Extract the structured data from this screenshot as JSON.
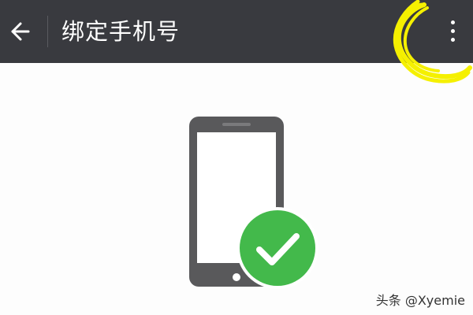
{
  "header": {
    "title": "绑定手机号",
    "back_icon": "arrow-left-icon",
    "more_icon": "more-vertical-icon",
    "background_color": "#393a3f",
    "text_color": "#ffffff"
  },
  "annotation": {
    "type": "hand-drawn circle",
    "color": "#f5f000",
    "target": "more-options-button"
  },
  "illustration": {
    "phone_icon": "smartphone-icon",
    "phone_color": "#59595b",
    "check_icon": "check-circle-icon",
    "check_color": "#43b94b"
  },
  "watermark": {
    "text": "头条 @Xyemie"
  }
}
